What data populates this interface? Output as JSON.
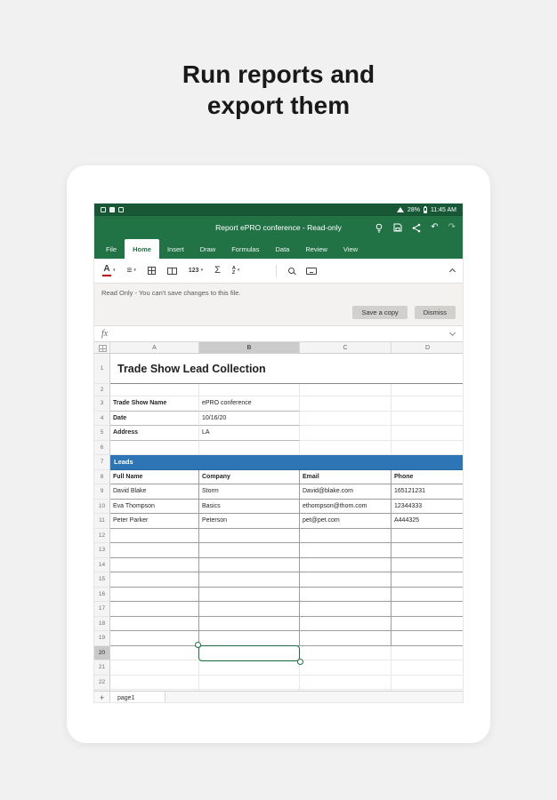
{
  "hero": {
    "title_lines": [
      "Run reports and",
      "export them"
    ]
  },
  "status_bar": {
    "battery_percent": "28%",
    "time": "11:45 AM",
    "left_icons": [
      "notification-icon",
      "notification-icon",
      "notification-icon"
    ],
    "right_icons": [
      "wifi-icon",
      "battery-icon"
    ]
  },
  "title_bar": {
    "title": "Report ePRO conference - Read-only",
    "icons": [
      "lightbulb-icon",
      "save-icon",
      "share-icon",
      "undo-icon",
      "redo-icon"
    ],
    "glyphs": {
      "undo": "↶",
      "redo": "↷"
    }
  },
  "menu": {
    "items": [
      {
        "label": "File",
        "active": false
      },
      {
        "label": "Home",
        "active": true
      },
      {
        "label": "Insert",
        "active": false
      },
      {
        "label": "Draw",
        "active": false
      },
      {
        "label": "Formulas",
        "active": false
      },
      {
        "label": "Data",
        "active": false
      },
      {
        "label": "Review",
        "active": false
      },
      {
        "label": "View",
        "active": false
      }
    ]
  },
  "toolbar": {
    "icons": [
      "font-color",
      "alignment",
      "borders",
      "merge-cells",
      "number-format",
      "autosum",
      "sort-filter",
      "search",
      "keyboard",
      "collapse-ribbon"
    ],
    "glyphs": {
      "font_color": "A",
      "alignment": "≡",
      "number_format": "123",
      "autosum": "Σ",
      "sort_top": "A",
      "sort_bottom": "Z",
      "chevron": "▾"
    }
  },
  "readonly_banner": {
    "message": "Read Only - You can't save changes to this file.",
    "save_button": "Save a copy",
    "dismiss_button": "Dismiss"
  },
  "formula_bar": {
    "fx_label": "fx"
  },
  "sheet": {
    "columns": [
      "A",
      "B",
      "C",
      "D"
    ],
    "row_count": 23,
    "title": "Trade Show Lead Collection",
    "info_rows": [
      {
        "row": 3,
        "label": "Trade Show Name",
        "value": "ePRO conference"
      },
      {
        "row": 4,
        "label": "Date",
        "value": "10/16/20"
      },
      {
        "row": 5,
        "label": "Address",
        "value": "LA"
      }
    ],
    "leads_row": 7,
    "leads_header": "Leads",
    "table_header_row": 8,
    "table_headers": [
      "Full Name",
      "Company",
      "Email",
      "Phone"
    ],
    "table_rows": [
      [
        "David Blake",
        "Storm",
        "David@blake.com",
        "165121231"
      ],
      [
        "Eva Thompson",
        "Basics",
        "ethompson@thom.com",
        "12344333"
      ],
      [
        "Peter Parker",
        "Peterson",
        "pet@pet.com",
        "A444325"
      ]
    ],
    "selection": {
      "cell": "B20",
      "column": "B",
      "row": 20
    }
  },
  "sheet_tabs": {
    "add_label": "+",
    "tabs": [
      {
        "label": "page1",
        "active": true
      }
    ]
  },
  "colors": {
    "page_bg": "#f1f1f1",
    "excel_green": "#217346",
    "excel_green_dark": "#185736",
    "leads_blue": "#2e75b6",
    "selection_green": "#1e6e43",
    "font_color_red": "#c00000"
  }
}
